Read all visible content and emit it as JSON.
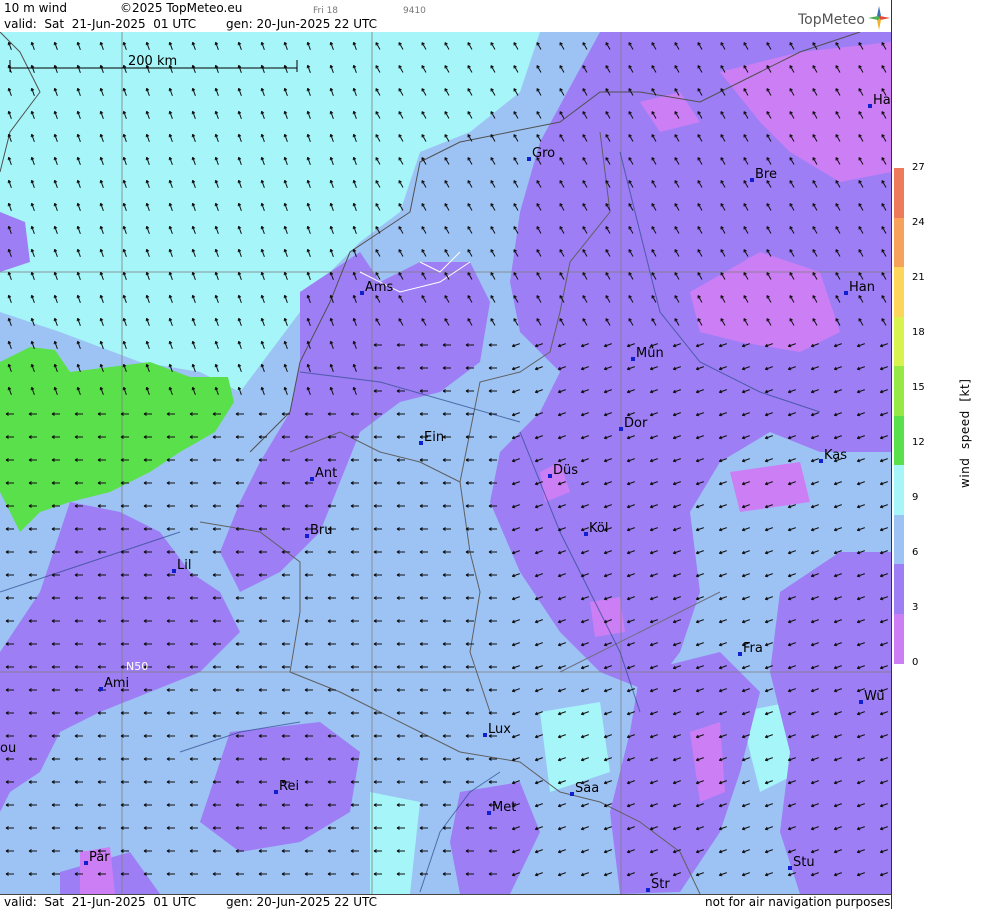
{
  "header": {
    "product": "10 m wind",
    "copyright": "©2025 TopMeteo.eu",
    "day_hint": "Fri 18",
    "code_hint": "9410",
    "valid_label": "valid:  Sat  21-Jun-2025  01 UTC",
    "gen_label": "gen: 20-Jun-2025 22 UTC",
    "logo_text": "TopMeteo"
  },
  "footer": {
    "valid_label": "valid:  Sat  21-Jun-2025  01 UTC",
    "gen_label": "gen: 20-Jun-2025 22 UTC",
    "notice": "not for air navigation purposes"
  },
  "map": {
    "scale_label": "200 km",
    "lat_label": "N50",
    "cities": [
      {
        "name": "Gro"
      },
      {
        "name": "Bre"
      },
      {
        "name": "Ha"
      },
      {
        "name": "Ams"
      },
      {
        "name": "Han"
      },
      {
        "name": "Mün"
      },
      {
        "name": "Dor"
      },
      {
        "name": "Ein"
      },
      {
        "name": "Kas"
      },
      {
        "name": "Düs"
      },
      {
        "name": "Ant"
      },
      {
        "name": "Köl"
      },
      {
        "name": "Bru"
      },
      {
        "name": "Lil"
      },
      {
        "name": "Fra"
      },
      {
        "name": "Ami"
      },
      {
        "name": "Wü"
      },
      {
        "name": "Lux"
      },
      {
        "name": "ou"
      },
      {
        "name": "Rei"
      },
      {
        "name": "Saa"
      },
      {
        "name": "Met"
      },
      {
        "name": "Par"
      },
      {
        "name": "Stu"
      },
      {
        "name": "Str"
      }
    ]
  },
  "legend": {
    "title": "wind  speed  [kt]",
    "ticks": [
      "27",
      "24",
      "21",
      "18",
      "15",
      "12",
      "9",
      "6",
      "3",
      "0"
    ],
    "colors": [
      "#ee7a5c",
      "#f6a25a",
      "#fbd65a",
      "#d8f250",
      "#96e847",
      "#5ae04a",
      "#a6f5f8",
      "#9dc3f5",
      "#9d7ef5",
      "#cc7ef5"
    ]
  }
}
